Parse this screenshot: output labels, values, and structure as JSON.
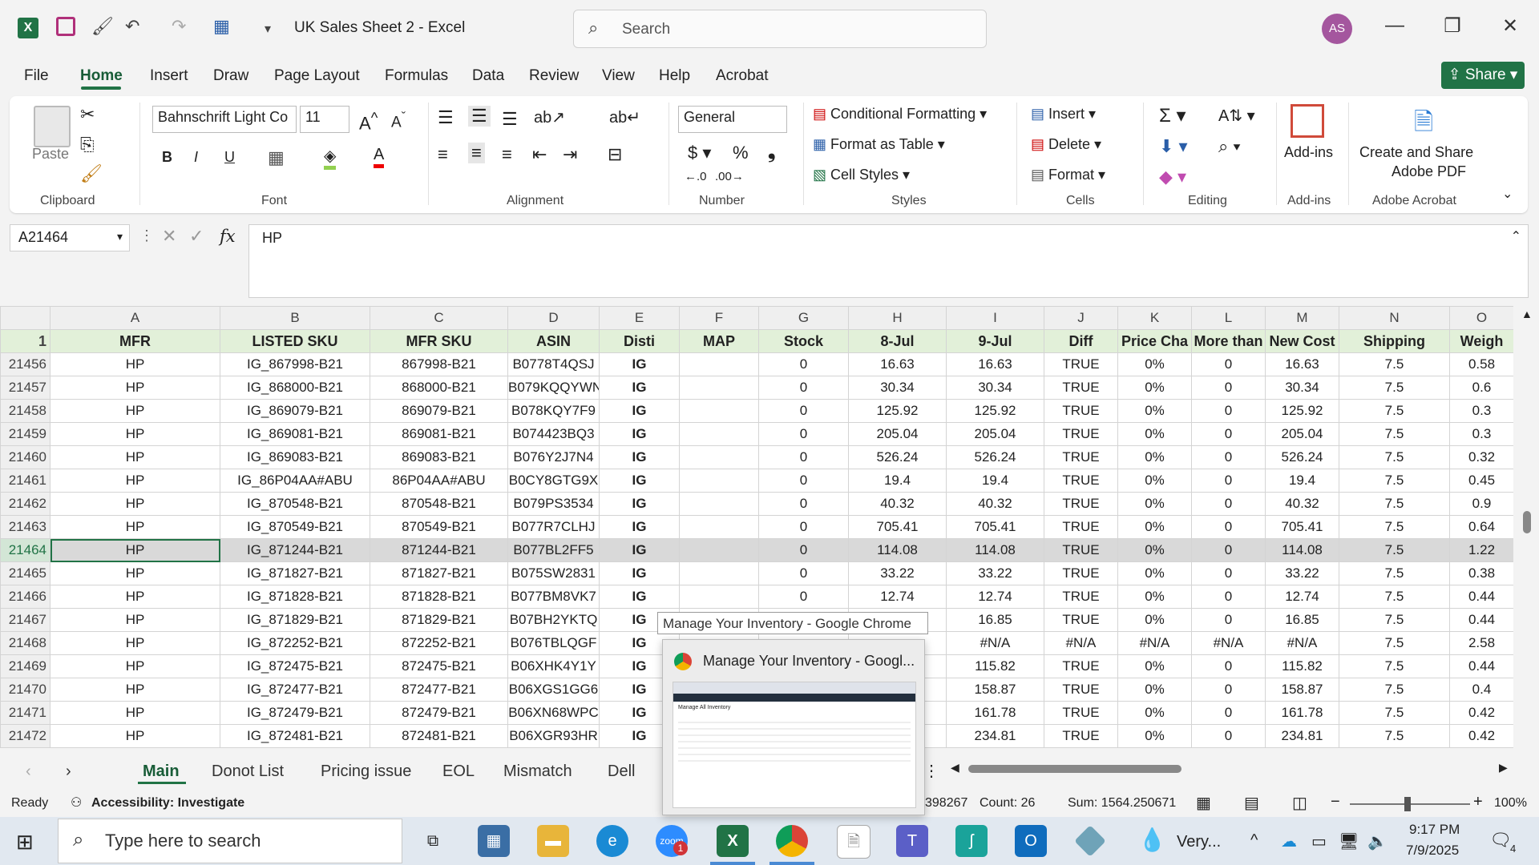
{
  "app": {
    "title": "UK Sales Sheet 2  -  Excel",
    "search_placeholder": "Search",
    "avatar": "AS",
    "share": "Share"
  },
  "menu": [
    "File",
    "Home",
    "Insert",
    "Draw",
    "Page Layout",
    "Formulas",
    "Data",
    "Review",
    "View",
    "Help",
    "Acrobat"
  ],
  "ribbon": {
    "clipboard": {
      "label": "Clipboard",
      "paste": "Paste"
    },
    "font": {
      "label": "Font",
      "family": "Bahnschrift Light Co",
      "size": "11"
    },
    "alignment": {
      "label": "Alignment"
    },
    "number": {
      "label": "Number",
      "format": "General"
    },
    "styles": {
      "label": "Styles",
      "conditional": "Conditional Formatting",
      "table": "Format as Table",
      "cell_styles": "Cell Styles"
    },
    "cells": {
      "label": "Cells",
      "insert": "Insert",
      "delete": "Delete",
      "format": "Format"
    },
    "editing": {
      "label": "Editing"
    },
    "addins": {
      "label": "Add-ins",
      "button": "Add-ins"
    },
    "acrobat": {
      "label": "Adobe Acrobat",
      "button_line1": "Create and Share",
      "button_line2": "Adobe PDF"
    }
  },
  "formula_bar": {
    "name_box": "A21464",
    "fx": "fx",
    "value": "HP"
  },
  "grid": {
    "columns": [
      "A",
      "B",
      "C",
      "D",
      "E",
      "F",
      "G",
      "H",
      "I",
      "J",
      "K",
      "L",
      "M",
      "N",
      "O"
    ],
    "header_row": {
      "num": "1",
      "cells": [
        "MFR",
        "LISTED SKU",
        "MFR SKU",
        "ASIN",
        "Disti",
        "MAP",
        "Stock",
        "8-Jul",
        "9-Jul",
        "Diff",
        "Price Cha",
        "More than",
        "New Cost",
        "Shipping",
        "Weigh"
      ]
    },
    "rows": [
      {
        "num": "21456",
        "cells": [
          "HP",
          "IG_867998-B21",
          "867998-B21",
          "B0778T4QSJ",
          "IG",
          "",
          "0",
          "16.63",
          "16.63",
          "TRUE",
          "0%",
          "0",
          "16.63",
          "7.5",
          "0.58"
        ]
      },
      {
        "num": "21457",
        "cells": [
          "HP",
          "IG_868000-B21",
          "868000-B21",
          "B079KQQYWN",
          "IG",
          "",
          "0",
          "30.34",
          "30.34",
          "TRUE",
          "0%",
          "0",
          "30.34",
          "7.5",
          "0.6"
        ]
      },
      {
        "num": "21458",
        "cells": [
          "HP",
          "IG_869079-B21",
          "869079-B21",
          "B078KQY7F9",
          "IG",
          "",
          "0",
          "125.92",
          "125.92",
          "TRUE",
          "0%",
          "0",
          "125.92",
          "7.5",
          "0.3"
        ]
      },
      {
        "num": "21459",
        "cells": [
          "HP",
          "IG_869081-B21",
          "869081-B21",
          "B074423BQ3",
          "IG",
          "",
          "0",
          "205.04",
          "205.04",
          "TRUE",
          "0%",
          "0",
          "205.04",
          "7.5",
          "0.3"
        ]
      },
      {
        "num": "21460",
        "cells": [
          "HP",
          "IG_869083-B21",
          "869083-B21",
          "B076Y2J7N4",
          "IG",
          "",
          "0",
          "526.24",
          "526.24",
          "TRUE",
          "0%",
          "0",
          "526.24",
          "7.5",
          "0.32"
        ]
      },
      {
        "num": "21461",
        "cells": [
          "HP",
          "IG_86P04AA#ABU",
          "86P04AA#ABU",
          "B0CY8GTG9X",
          "IG",
          "",
          "0",
          "19.4",
          "19.4",
          "TRUE",
          "0%",
          "0",
          "19.4",
          "7.5",
          "0.45"
        ]
      },
      {
        "num": "21462",
        "cells": [
          "HP",
          "IG_870548-B21",
          "870548-B21",
          "B079PS3534",
          "IG",
          "",
          "0",
          "40.32",
          "40.32",
          "TRUE",
          "0%",
          "0",
          "40.32",
          "7.5",
          "0.9"
        ]
      },
      {
        "num": "21463",
        "cells": [
          "HP",
          "IG_870549-B21",
          "870549-B21",
          "B077R7CLHJ",
          "IG",
          "",
          "0",
          "705.41",
          "705.41",
          "TRUE",
          "0%",
          "0",
          "705.41",
          "7.5",
          "0.64"
        ]
      },
      {
        "num": "21464",
        "sel": true,
        "cells": [
          "HP",
          "IG_871244-B21",
          "871244-B21",
          "B077BL2FF5",
          "IG",
          "",
          "0",
          "114.08",
          "114.08",
          "TRUE",
          "0%",
          "0",
          "114.08",
          "7.5",
          "1.22"
        ]
      },
      {
        "num": "21465",
        "cells": [
          "HP",
          "IG_871827-B21",
          "871827-B21",
          "B075SW2831",
          "IG",
          "",
          "0",
          "33.22",
          "33.22",
          "TRUE",
          "0%",
          "0",
          "33.22",
          "7.5",
          "0.38"
        ]
      },
      {
        "num": "21466",
        "cells": [
          "HP",
          "IG_871828-B21",
          "871828-B21",
          "B077BM8VK7",
          "IG",
          "",
          "0",
          "12.74",
          "12.74",
          "TRUE",
          "0%",
          "0",
          "12.74",
          "7.5",
          "0.44"
        ]
      },
      {
        "num": "21467",
        "cells": [
          "HP",
          "IG_871829-B21",
          "871829-B21",
          "B07BH2YKTQ",
          "IG",
          "",
          "",
          "",
          "16.85",
          "TRUE",
          "0%",
          "0",
          "16.85",
          "7.5",
          "0.44"
        ]
      },
      {
        "num": "21468",
        "cells": [
          "HP",
          "IG_872252-B21",
          "872252-B21",
          "B076TBLQGF",
          "IG",
          "",
          "",
          "",
          "#N/A",
          "#N/A",
          "#N/A",
          "#N/A",
          "#N/A",
          "7.5",
          "2.58"
        ]
      },
      {
        "num": "21469",
        "cells": [
          "HP",
          "IG_872475-B21",
          "872475-B21",
          "B06XHK4Y1Y",
          "IG",
          "",
          "",
          "",
          "115.82",
          "TRUE",
          "0%",
          "0",
          "115.82",
          "7.5",
          "0.44"
        ]
      },
      {
        "num": "21470",
        "cells": [
          "HP",
          "IG_872477-B21",
          "872477-B21",
          "B06XGS1GG6",
          "IG",
          "",
          "",
          "",
          "158.87",
          "TRUE",
          "0%",
          "0",
          "158.87",
          "7.5",
          "0.4"
        ]
      },
      {
        "num": "21471",
        "cells": [
          "HP",
          "IG_872479-B21",
          "872479-B21",
          "B06XN68WPC",
          "IG",
          "",
          "",
          "",
          "161.78",
          "TRUE",
          "0%",
          "0",
          "161.78",
          "7.5",
          "0.42"
        ]
      },
      {
        "num": "21472",
        "cells": [
          "HP",
          "IG_872481-B21",
          "872481-B21",
          "B06XGR93HR",
          "IG",
          "",
          "",
          "",
          "234.81",
          "TRUE",
          "0%",
          "0",
          "234.81",
          "7.5",
          "0.42"
        ]
      }
    ]
  },
  "sheet_tabs": [
    "Main",
    "Donot List",
    "Pricing issue",
    "EOL",
    "Mismatch",
    "Dell"
  ],
  "status": {
    "ready": "Ready",
    "accessibility": "Accessibility: Investigate",
    "average": "398267",
    "count": "Count: 26",
    "sum": "Sum: 1564.250671",
    "zoom": "100%"
  },
  "tooltip": "Manage Your Inventory - Google Chrome",
  "preview": {
    "title": "Manage Your Inventory - Googl...",
    "thumb_heading": "Manage All Inventory"
  },
  "taskbar": {
    "search_placeholder": "Type here to search",
    "weather": "Very...",
    "time": "9:17 PM",
    "date": "7/9/2025",
    "notif": "4",
    "outlook_badge": "1"
  }
}
